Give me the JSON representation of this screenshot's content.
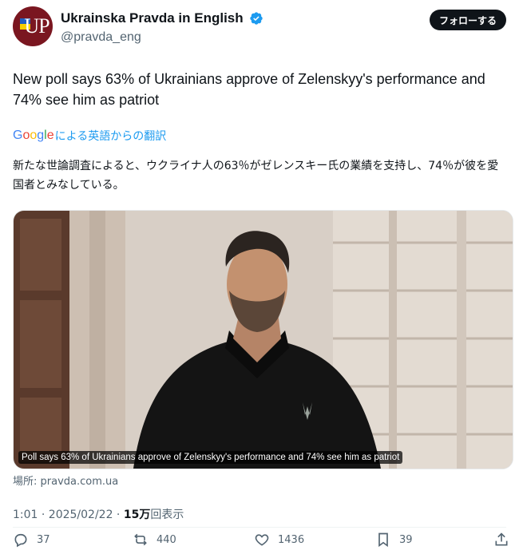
{
  "account": {
    "name": "Ukrainska Pravda in English",
    "handle": "@pravda_eng",
    "avatar_text": "UP"
  },
  "follow_label": "フォローする",
  "tweet": {
    "text": "New poll says 63% of Ukrainians approve of Zelenskyy's performance and 74% see him as patriot",
    "translate_brand": "Google",
    "translate_label": "による英語からの翻訳",
    "translated_text": "新たな世論調査によると、ウクライナ人の63％がゼレンスキー氏の業績を支持し、74％が彼を愛国者とみなしている。"
  },
  "media": {
    "caption": "Poll says 63% of Ukrainians approve of Zelenskyy's performance and 74% see him as patriot",
    "source": "場所: pravda.com.ua"
  },
  "meta": {
    "time": "1:01 · 2025/02/22 · ",
    "views_count": "15万",
    "views_label": "回表示"
  },
  "actions": {
    "replies": "37",
    "reposts": "440",
    "likes": "1436",
    "bookmarks": "39"
  },
  "colors": {
    "accent": "#1d9bf0",
    "text": "#0f1419",
    "muted": "#536471"
  }
}
